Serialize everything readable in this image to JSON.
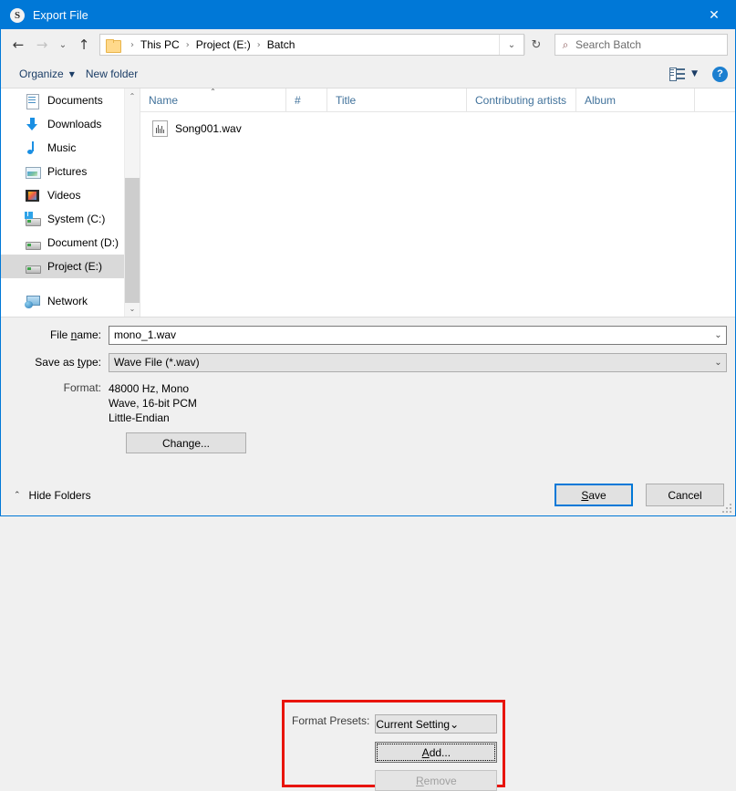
{
  "window": {
    "title": "Export File",
    "app_icon": "S",
    "close_label": "✕"
  },
  "address_bar": {
    "back_icon": "←",
    "forward_icon": "→",
    "recent_icon": "⌄",
    "up_icon": "↑",
    "folder_icon": "folder-icon",
    "crumbs": [
      "This PC",
      "Project (E:)",
      "Batch"
    ],
    "separator": "›",
    "dropdown_icon": "⌄",
    "refresh_icon": "↻",
    "search_icon": "⌕",
    "search_placeholder": "Search Batch"
  },
  "command_bar": {
    "organize_label": "Organize",
    "organize_caret": "▼",
    "new_folder_label": "New folder",
    "view_caret": "▼",
    "help_label": "?"
  },
  "sidebar": {
    "items": [
      {
        "label": "Documents",
        "icon": "documents-icon",
        "selected": false
      },
      {
        "label": "Downloads",
        "icon": "downloads-icon",
        "selected": false
      },
      {
        "label": "Music",
        "icon": "music-icon",
        "selected": false
      },
      {
        "label": "Pictures",
        "icon": "pictures-icon",
        "selected": false
      },
      {
        "label": "Videos",
        "icon": "videos-icon",
        "selected": false
      },
      {
        "label": "System (C:)",
        "icon": "drive-icon",
        "selected": false
      },
      {
        "label": "Document (D:)",
        "icon": "drive-icon",
        "selected": false
      },
      {
        "label": "Project (E:)",
        "icon": "drive-icon",
        "selected": true
      },
      {
        "label": "Network",
        "icon": "network-icon",
        "selected": false
      }
    ],
    "scroll_up_icon": "⌃",
    "scroll_down_icon": "⌄"
  },
  "file_list": {
    "columns": [
      {
        "label": "Name",
        "sorted": true,
        "sort_icon": "⌃"
      },
      {
        "label": "#",
        "sorted": false
      },
      {
        "label": "Title",
        "sorted": false
      },
      {
        "label": "Contributing artists",
        "sorted": false
      },
      {
        "label": "Album",
        "sorted": false
      }
    ],
    "rows": [
      {
        "name": "Song001.wav",
        "icon": "wave-file-icon"
      }
    ]
  },
  "form": {
    "file_name_label_pre": "File ",
    "file_name_label_key": "n",
    "file_name_label_post": "ame:",
    "file_name_value": "mono_1.wav",
    "save_as_type_label_pre": "Save as ",
    "save_as_type_label_key": "t",
    "save_as_type_label_post": "ype:",
    "save_as_type_value": "Wave File (*.wav)",
    "format_label": "Format:",
    "format_lines": [
      "48000 Hz, Mono",
      "Wave, 16-bit PCM",
      "Little-Endian"
    ],
    "change_button": "Change...",
    "combo_chevron": "⌄"
  },
  "format_presets": {
    "label": "Format Presets:",
    "selected": "Current Setting",
    "chevron": "⌄",
    "add_label_pre": "",
    "add_label_key": "A",
    "add_label_post": "dd...",
    "remove_label_pre": "",
    "remove_label_key": "R",
    "remove_label_post": "emove",
    "remove_enabled": false,
    "highlight_color": "#e8140c"
  },
  "footer": {
    "hide_folders_label": "Hide Folders",
    "hide_folders_caret": "⌃",
    "save_label_pre": "",
    "save_label_key": "S",
    "save_label_post": "ave",
    "cancel_label": "Cancel"
  }
}
